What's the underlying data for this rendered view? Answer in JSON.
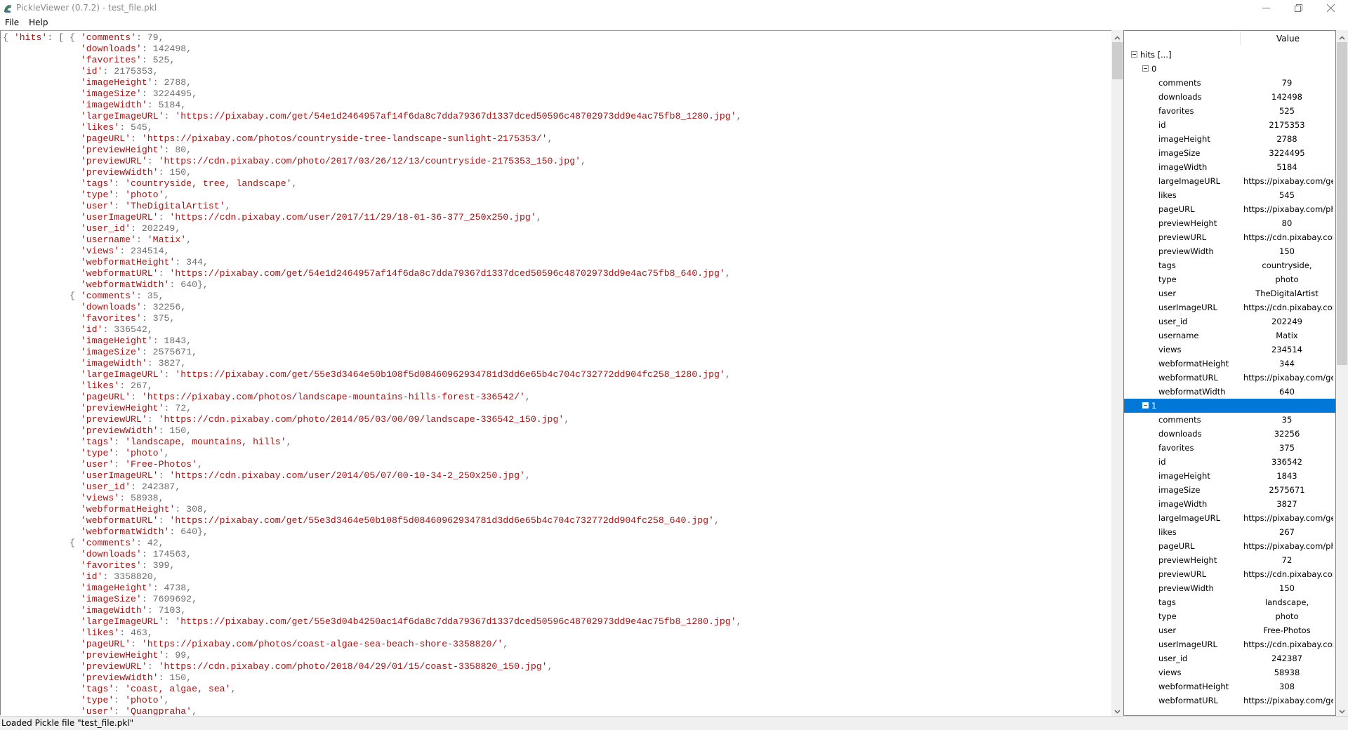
{
  "window": {
    "title": "PickleViewer (0.7.2) - test_file.pkl",
    "icon": "python-snake-icon",
    "controls": [
      "minimize",
      "maximize",
      "close"
    ]
  },
  "menu": {
    "items": [
      {
        "label": "File"
      },
      {
        "label": "Help"
      }
    ]
  },
  "code": {
    "lines": [
      "{ 'hits': [ { 'comments': 79,",
      "              'downloads': 142498,",
      "              'favorites': 525,",
      "              'id': 2175353,",
      "              'imageHeight': 2788,",
      "              'imageSize': 3224495,",
      "              'imageWidth': 5184,",
      "              'largeImageURL': 'https://pixabay.com/get/54e1d2464957af14f6da8c7dda79367d1337dced50596c48702973dd9e4ac75fb8_1280.jpg',",
      "              'likes': 545,",
      "              'pageURL': 'https://pixabay.com/photos/countryside-tree-landscape-sunlight-2175353/',",
      "              'previewHeight': 80,",
      "              'previewURL': 'https://cdn.pixabay.com/photo/2017/03/26/12/13/countryside-2175353_150.jpg',",
      "              'previewWidth': 150,",
      "              'tags': 'countryside, tree, landscape',",
      "              'type': 'photo',",
      "              'user': 'TheDigitalArtist',",
      "              'userImageURL': 'https://cdn.pixabay.com/user/2017/11/29/18-01-36-377_250x250.jpg',",
      "              'user_id': 202249,",
      "              'username': 'Matix',",
      "              'views': 234514,",
      "              'webformatHeight': 344,",
      "              'webformatURL': 'https://pixabay.com/get/54e1d2464957af14f6da8c7dda79367d1337dced50596c48702973dd9e4ac75fb8_640.jpg',",
      "              'webformatWidth': 640},",
      "            { 'comments': 35,",
      "              'downloads': 32256,",
      "              'favorites': 375,",
      "              'id': 336542,",
      "              'imageHeight': 1843,",
      "              'imageSize': 2575671,",
      "              'imageWidth': 3827,",
      "              'largeImageURL': 'https://pixabay.com/get/55e3d3464e50b108f5d08460962934781d3dd6e65b4c704c732772dd904fc258_1280.jpg',",
      "              'likes': 267,",
      "              'pageURL': 'https://pixabay.com/photos/landscape-mountains-hills-forest-336542/',",
      "              'previewHeight': 72,",
      "              'previewURL': 'https://cdn.pixabay.com/photo/2014/05/03/00/09/landscape-336542_150.jpg',",
      "              'previewWidth': 150,",
      "              'tags': 'landscape, mountains, hills',",
      "              'type': 'photo',",
      "              'user': 'Free-Photos',",
      "              'userImageURL': 'https://cdn.pixabay.com/user/2014/05/07/00-10-34-2_250x250.jpg',",
      "              'user_id': 242387,",
      "              'views': 58938,",
      "              'webformatHeight': 308,",
      "              'webformatURL': 'https://pixabay.com/get/55e3d3464e50b108f5d08460962934781d3dd6e65b4c704c732772dd904fc258_640.jpg',",
      "              'webformatWidth': 640},",
      "            { 'comments': 42,",
      "              'downloads': 174563,",
      "              'favorites': 399,",
      "              'id': 3358820,",
      "              'imageHeight': 4738,",
      "              'imageSize': 7699692,",
      "              'imageWidth': 7103,",
      "              'largeImageURL': 'https://pixabay.com/get/55e3d04b4250ac14f6da8c7dda79367d1337dced50596c48702973dd9e4ac75fb8_1280.jpg',",
      "              'likes': 463,",
      "              'pageURL': 'https://pixabay.com/photos/coast-algae-sea-beach-shore-3358820/',",
      "              'previewHeight': 99,",
      "              'previewURL': 'https://cdn.pixabay.com/photo/2018/04/29/01/15/coast-3358820_150.jpg',",
      "              'previewWidth': 150,",
      "              'tags': 'coast, algae, sea',",
      "              'type': 'photo',",
      "              'user': 'Quangpraha',"
    ]
  },
  "tree": {
    "header": {
      "key_label": "",
      "value_label": "Value"
    },
    "selected_color": "#0078D7",
    "rows": [
      {
        "level": 0,
        "toggle": true,
        "name": "hits [...]",
        "value": ""
      },
      {
        "level": 1,
        "toggle": true,
        "name": "0",
        "value": ""
      },
      {
        "level": 2,
        "name": "comments",
        "value": "79"
      },
      {
        "level": 2,
        "name": "downloads",
        "value": "142498"
      },
      {
        "level": 2,
        "name": "favorites",
        "value": "525"
      },
      {
        "level": 2,
        "name": "id",
        "value": "2175353"
      },
      {
        "level": 2,
        "name": "imageHeight",
        "value": "2788"
      },
      {
        "level": 2,
        "name": "imageSize",
        "value": "3224495"
      },
      {
        "level": 2,
        "name": "imageWidth",
        "value": "5184"
      },
      {
        "level": 2,
        "name": "largeImageURL",
        "value": "https://pixabay.com/get",
        "clipped": true
      },
      {
        "level": 2,
        "name": "likes",
        "value": "545"
      },
      {
        "level": 2,
        "name": "pageURL",
        "value": "https://pixabay.com/ph",
        "clipped": true
      },
      {
        "level": 2,
        "name": "previewHeight",
        "value": "80"
      },
      {
        "level": 2,
        "name": "previewURL",
        "value": "https://cdn.pixabay.com",
        "clipped": true
      },
      {
        "level": 2,
        "name": "previewWidth",
        "value": "150"
      },
      {
        "level": 2,
        "name": "tags",
        "value": "countryside,"
      },
      {
        "level": 2,
        "name": "type",
        "value": "photo"
      },
      {
        "level": 2,
        "name": "user",
        "value": "TheDigitalArtist"
      },
      {
        "level": 2,
        "name": "userImageURL",
        "value": "https://cdn.pixabay.com",
        "clipped": true
      },
      {
        "level": 2,
        "name": "user_id",
        "value": "202249"
      },
      {
        "level": 2,
        "name": "username",
        "value": "Matix"
      },
      {
        "level": 2,
        "name": "views",
        "value": "234514"
      },
      {
        "level": 2,
        "name": "webformatHeight",
        "value": "344"
      },
      {
        "level": 2,
        "name": "webformatURL",
        "value": "https://pixabay.com/get",
        "clipped": true
      },
      {
        "level": 2,
        "name": "webformatWidth",
        "value": "640"
      },
      {
        "level": 1,
        "toggle": true,
        "name": "1",
        "value": "",
        "selected": true
      },
      {
        "level": 2,
        "name": "comments",
        "value": "35"
      },
      {
        "level": 2,
        "name": "downloads",
        "value": "32256"
      },
      {
        "level": 2,
        "name": "favorites",
        "value": "375"
      },
      {
        "level": 2,
        "name": "id",
        "value": "336542"
      },
      {
        "level": 2,
        "name": "imageHeight",
        "value": "1843"
      },
      {
        "level": 2,
        "name": "imageSize",
        "value": "2575671"
      },
      {
        "level": 2,
        "name": "imageWidth",
        "value": "3827"
      },
      {
        "level": 2,
        "name": "largeImageURL",
        "value": "https://pixabay.com/get",
        "clipped": true
      },
      {
        "level": 2,
        "name": "likes",
        "value": "267"
      },
      {
        "level": 2,
        "name": "pageURL",
        "value": "https://pixabay.com/ph",
        "clipped": true
      },
      {
        "level": 2,
        "name": "previewHeight",
        "value": "72"
      },
      {
        "level": 2,
        "name": "previewURL",
        "value": "https://cdn.pixabay.com",
        "clipped": true
      },
      {
        "level": 2,
        "name": "previewWidth",
        "value": "150"
      },
      {
        "level": 2,
        "name": "tags",
        "value": "landscape,"
      },
      {
        "level": 2,
        "name": "type",
        "value": "photo"
      },
      {
        "level": 2,
        "name": "user",
        "value": "Free-Photos"
      },
      {
        "level": 2,
        "name": "userImageURL",
        "value": "https://cdn.pixabay.com",
        "clipped": true
      },
      {
        "level": 2,
        "name": "user_id",
        "value": "242387"
      },
      {
        "level": 2,
        "name": "views",
        "value": "58938"
      },
      {
        "level": 2,
        "name": "webformatHeight",
        "value": "308"
      },
      {
        "level": 2,
        "name": "webformatURL",
        "value": "https://pixabay.com/get",
        "clipped": true
      }
    ]
  },
  "status": {
    "text": "Loaded Pickle file \"test_file.pkl\""
  }
}
